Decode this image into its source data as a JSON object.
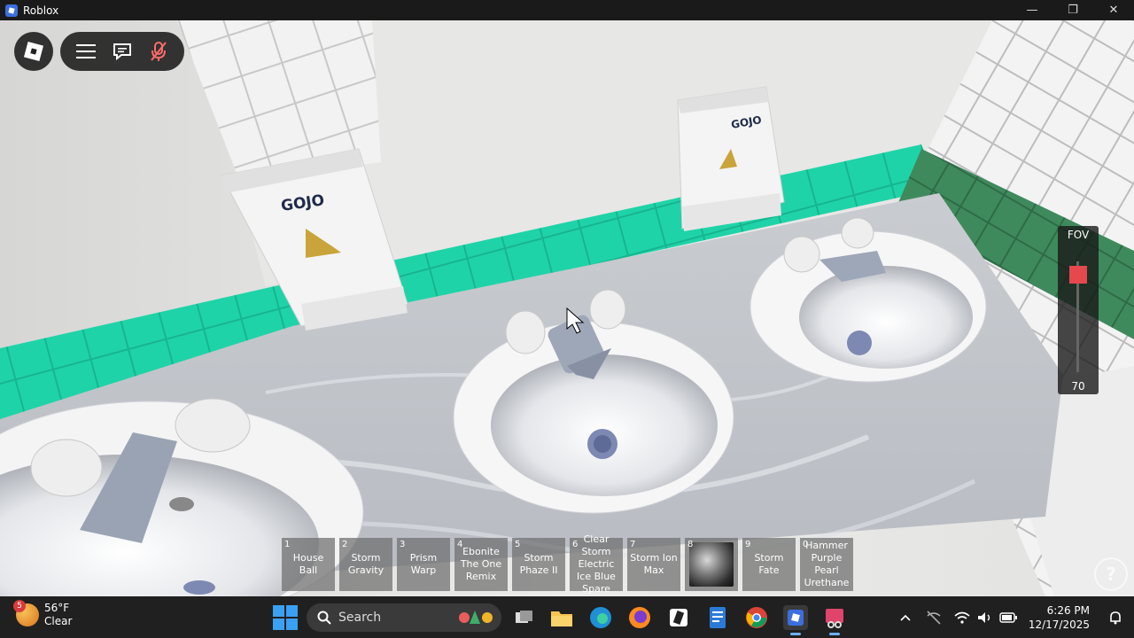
{
  "window": {
    "title": "Roblox",
    "minimize": "—",
    "maximize": "❐",
    "close": "✕"
  },
  "fov": {
    "label": "FOV",
    "value": "70",
    "level": 0.05
  },
  "hotbar": [
    {
      "num": "1",
      "label": "House Ball"
    },
    {
      "num": "2",
      "label": "Storm Gravity"
    },
    {
      "num": "3",
      "label": "Prism Warp"
    },
    {
      "num": "4",
      "label": "Ebonite The One Remix"
    },
    {
      "num": "5",
      "label": "Storm Phaze II"
    },
    {
      "num": "6",
      "label": "Clear Storm Electric Ice Blue Spare"
    },
    {
      "num": "7",
      "label": "Storm Ion Max"
    },
    {
      "num": "8",
      "label": ""
    },
    {
      "num": "9",
      "label": "Storm Fate"
    },
    {
      "num": "0",
      "label": "Hammer Purple Pearl Urethane"
    }
  ],
  "help": "?",
  "scene_text": {
    "dispenser_brand_left": "GOJO",
    "dispenser_brand_right": "GOJO"
  },
  "taskbar": {
    "weather_temp": "56°F",
    "weather_cond": "Clear",
    "weather_badge": "5",
    "search_label": "Search",
    "time": "6:26 PM",
    "date": "12/17/2025"
  },
  "colors": {
    "tile_teal": "#1fd3a8",
    "tile_green": "#3f8a5d",
    "fov_handle": "#e5484d",
    "taskbar_bg": "#202020"
  }
}
